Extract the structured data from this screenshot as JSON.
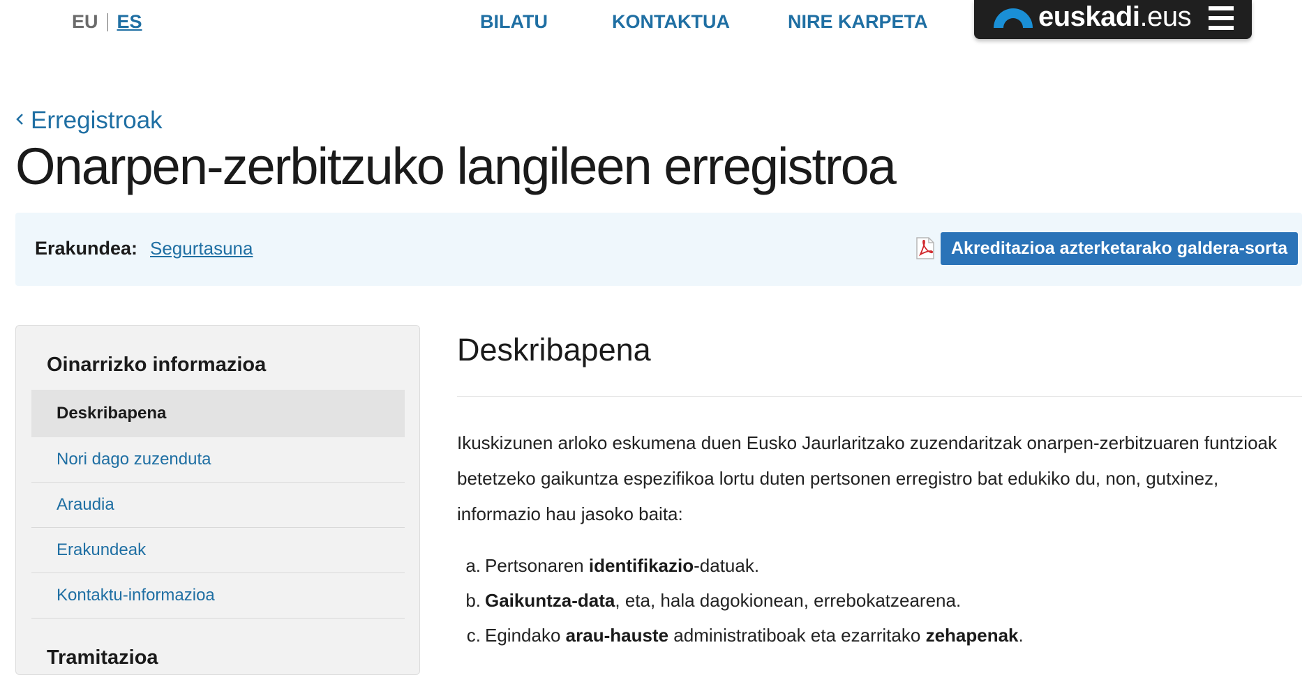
{
  "header": {
    "lang_eu": "EU",
    "lang_es": "ES",
    "nav": {
      "search": "BILATU",
      "contact": "KONTAKTUA",
      "my_folder": "NIRE KARPETA"
    },
    "brand": {
      "bold": "euskadi",
      "thin": ".eus",
      "mark_color": "#1a8fd6"
    }
  },
  "breadcrumb": {
    "back_label": "Erregistroak"
  },
  "page_title": "Onarpen-zerbitzuko langileen erregistroa",
  "organization": {
    "label": "Erakundea:",
    "value": "Segurtasuna",
    "pdf_button": "Akreditazioa azterketarako galdera-sorta"
  },
  "sidebar": {
    "heading": "Oinarrizko informazioa",
    "items": [
      {
        "label": "Deskribapena",
        "active": true
      },
      {
        "label": "Nori dago zuzenduta",
        "active": false
      },
      {
        "label": "Araudia",
        "active": false
      },
      {
        "label": "Erakundeak",
        "active": false
      },
      {
        "label": "Kontaktu-informazioa",
        "active": false
      }
    ],
    "heading_2": "Tramitazioa"
  },
  "content": {
    "title": "Deskribapena",
    "paragraph": "Ikuskizunen arloko eskumena duen Eusko Jaurlaritzako zuzendaritzak onarpen-zerbitzuaren funtzioak betetzeko gaikuntza espezifikoa lortu duten pertsonen erregistro bat edukiko du, non, gutxinez, informazio hau jasoko baita:",
    "list": [
      {
        "marker": "a.",
        "pre": "Pertsonaren ",
        "bold": "identifikazio",
        "post": "-datuak.",
        "bold2": "",
        "post2": ""
      },
      {
        "marker": "b.",
        "pre": "",
        "bold": "Gaikuntza-data",
        "post": ", eta, hala dagokionean, errebokatzearena.",
        "bold2": "",
        "post2": ""
      },
      {
        "marker": "c.",
        "pre": "Egindako ",
        "bold": "arau-hauste",
        "post": " administratiboak eta ezarritako ",
        "bold2": "zehapenak",
        "post2": "."
      }
    ]
  },
  "colors": {
    "link": "#1f6fa3",
    "button": "#2a73b8",
    "org_band": "#eff7fc",
    "sidebar_bg": "#f2f2f2",
    "active_item": "#e3e3e3"
  }
}
